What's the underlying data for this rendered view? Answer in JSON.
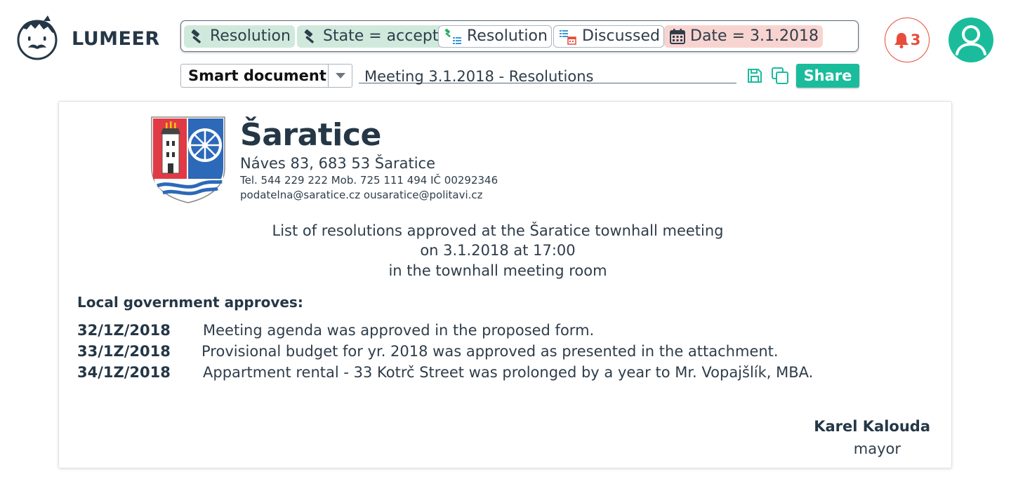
{
  "app": {
    "brand": "LUMEER"
  },
  "search_chips": [
    {
      "label": "Resolution",
      "icon": "gavel-icon",
      "style": "green"
    },
    {
      "label": "State = accept",
      "icon": "gavel-icon",
      "style": "green"
    },
    {
      "label": "Resolution",
      "icon": "gavel-link-icon",
      "style": "white"
    },
    {
      "label": "Discussed",
      "icon": "list-calendar-icon",
      "style": "white"
    },
    {
      "label": "Date = 3.1.2018",
      "icon": "calendar-icon",
      "style": "pink"
    }
  ],
  "notifications": {
    "count": "3",
    "color": "#e74c3c"
  },
  "toolbar": {
    "view_type": "Smart document",
    "document_name": "Meeting 3.1.2018 - Resolutions",
    "share_label": "Share",
    "accent": "#1abc9c"
  },
  "document": {
    "town": "Šaratice",
    "address": "Náves 83, 683 53 Šaratice",
    "contact": "Tel. 544 229 222  Mob. 725 111 494  IČ 00292346",
    "email": "podatelna@saratice.cz ousaratice@politavi.cz",
    "intro_lines": [
      "List of resolutions approved at the Šaratice townhall meeting",
      "on 3.1.2018 at 17:00",
      "in the townhall meeting room"
    ],
    "approves_heading": "Local government approves:",
    "resolutions": [
      {
        "number": "32/1Z/2018",
        "text": "Meeting agenda was approved in  the proposed form."
      },
      {
        "number": "33/1Z/2018",
        "text": "Provisional budget for yr. 2018 was approved as presented in the attachment."
      },
      {
        "number": "34/1Z/2018",
        "text": "Appartment rental - 33 Kotrč Street was prolonged by a year to Mr. Vopajšlík, MBA."
      }
    ],
    "signature_name": "Karel Kalouda",
    "signature_title": "mayor"
  }
}
